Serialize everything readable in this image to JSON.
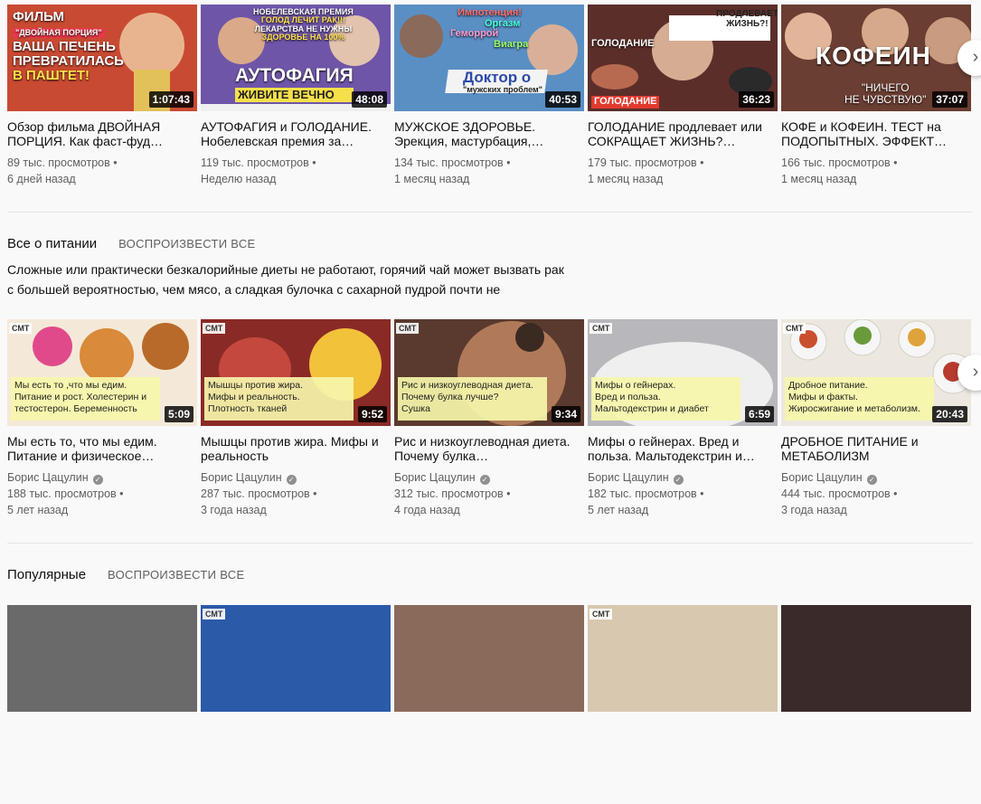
{
  "shelf1": {
    "videos": [
      {
        "title": "Обзор фильма ДВОЙНАЯ ПОРЦИЯ. Как фаст-фуд…",
        "views": "89 тыс. просмотров",
        "age": "6 дней назад",
        "duration": "1:07:43",
        "overlay": [
          "ФИЛЬМ",
          "\"ДВОЙНАЯ ПОРЦИЯ\"",
          "ВАША ПЕЧЕНЬ",
          "ПРЕВРАТИЛАСЬ",
          "В ПАШТЕТ!"
        ],
        "bg": "#b23a2c"
      },
      {
        "title": "АУТОФАГИЯ и ГОЛОДАНИЕ. Нобелевская премия за…",
        "views": "119 тыс. просмотров",
        "age": "Неделю назад",
        "duration": "48:08",
        "overlay": [
          "НОБЕЛЕВСКАЯ ПРЕМИЯ",
          "ГОЛОД ЛЕЧИТ РАК!!!",
          "ЛЕКАРСТВА НЕ НУЖНЫ",
          "ЗДОРОВЬЕ НА 100%",
          "АУТОФАГИЯ",
          "ЖИВИТЕ ВЕЧНО"
        ],
        "bg": "#6f55a8"
      },
      {
        "title": "МУЖСКОЕ ЗДОРОВЬЕ. Эрекция, мастурбация,…",
        "views": "134 тыс. просмотров",
        "age": "1 месяц назад",
        "duration": "40:53",
        "overlay": [
          "Импотенция!",
          "Оргазм",
          "Геморрой",
          "Виагра",
          "Доктор о",
          "\"мужских проблем\""
        ],
        "bg": "#5a8fc4"
      },
      {
        "title": "ГОЛОДАНИЕ продлевает или СОКРАЩАЕТ ЖИЗНЬ?…",
        "views": "179 тыс. просмотров",
        "age": "1 месяц назад",
        "duration": "36:23",
        "overlay": [
          "ПРОДЛЕВАЕТ",
          "ЖИЗНЬ?!",
          "ГОЛОДАНИЕ",
          "ГОЛОДАНИЕ"
        ],
        "bg": "#7a3a32"
      },
      {
        "title": "КОФЕ и КОФЕИН. ТЕСТ на ПОДОПЫТНЫХ. ЭФФЕКТ…",
        "views": "166 тыс. просмотров",
        "age": "1 месяц назад",
        "duration": "37:07",
        "overlay": [
          "КОФЕИН",
          "\"НИЧЕГО",
          "НЕ ЧУВСТВУЮ\""
        ],
        "bg": "#7c4b3a"
      }
    ]
  },
  "shelf2": {
    "title": "Все о питании",
    "play_all": "ВОСПРОИЗВЕСТИ ВСЕ",
    "description": "Сложные или практически безкалорийные диеты не работают, горячий чай может вызвать рак с большей вероятностью, чем мясо, а сладкая булочка с сахарной пудрой почти не",
    "videos": [
      {
        "title": "Мы есть то, что мы едим. Питание и физическое…",
        "channel": "Борис Цацулин",
        "views": "188 тыс. просмотров",
        "age": "5 лет назад",
        "duration": "5:09",
        "caption": [
          "Мы есть то ,что мы едим.",
          "Питание и рост. Холестерин и",
          "тестостерон. Беременность"
        ],
        "bg": "#d98a3a"
      },
      {
        "title": "Мышцы против жира. Мифы и реальность",
        "channel": "Борис Цацулин",
        "views": "287 тыс. просмотров",
        "age": "3 года назад",
        "duration": "9:52",
        "caption": [
          "Мышцы против жира.",
          "Мифы и реальность.",
          "Плотность тканей"
        ],
        "bg": "#b0413a"
      },
      {
        "title": "Рис и низкоуглеводная диета. Почему булка…",
        "channel": "Борис Цацулин",
        "views": "312 тыс. просмотров",
        "age": "4 года назад",
        "duration": "9:34",
        "caption": [
          "Рис и низкоуглеводная диета.",
          "Почему булка лучше?",
          "Сушка"
        ],
        "bg": "#8a5a44"
      },
      {
        "title": "Мифы о гейнерах. Вред и польза. Мальтодекстрин и…",
        "channel": "Борис Цацулин",
        "views": "182 тыс. просмотров",
        "age": "5 лет назад",
        "duration": "6:59",
        "caption": [
          "Мифы о гейнерах.",
          "Вред и польза.",
          "Мальтодекстрин и диабет"
        ],
        "bg": "#c9c9cc"
      },
      {
        "title": "ДРОБНОЕ ПИТАНИЕ и МЕТАБОЛИЗМ",
        "channel": "Борис Цацулин",
        "views": "444 тыс. просмотров",
        "age": "3 года назад",
        "duration": "20:43",
        "caption": [
          "Дробное питание.",
          "Мифы и факты.",
          "Жиросжигание и метаболизм."
        ],
        "bg": "#e9e6df"
      }
    ]
  },
  "shelf3": {
    "title": "Популярные",
    "play_all": "ВОСПРОИЗВЕСТИ ВСЕ"
  },
  "brand_tag": "СМТ",
  "icons": {
    "next": "chevron-right-icon",
    "verified": "check-circle-icon"
  }
}
